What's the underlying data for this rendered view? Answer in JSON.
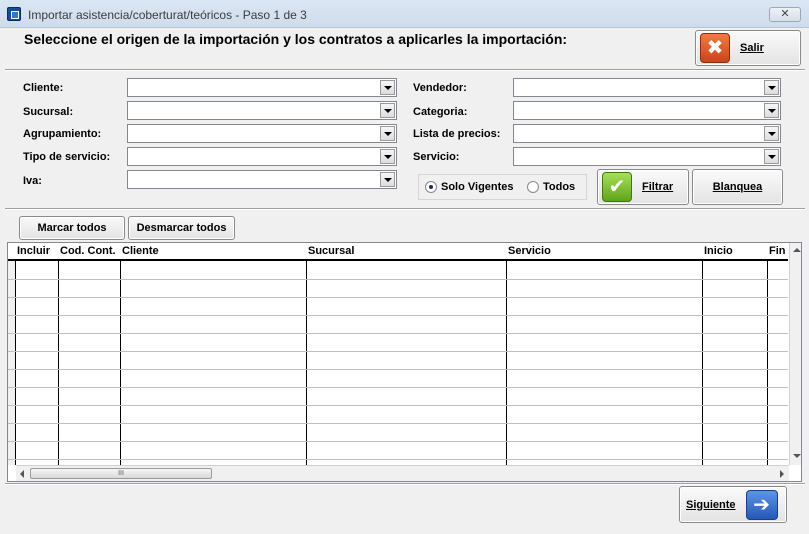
{
  "window": {
    "title": "Importar asistencia/coberturat/teóricos - Paso 1 de 3",
    "close": "✕"
  },
  "headline": "Seleccione el origen de la importación y los contratos a  aplicarles la importación:",
  "buttons": {
    "salir": "Salir",
    "filtrar": "Filtrar",
    "blanquea": "Blanquea",
    "marcar_todos": "Marcar todos",
    "desmarcar_todos": "Desmarcar todos",
    "siguiente": "Siguiente"
  },
  "filters": {
    "left": [
      {
        "label": "Cliente:",
        "value": ""
      },
      {
        "label": "Sucursal:",
        "value": ""
      },
      {
        "label": "Agrupamiento:",
        "value": ""
      },
      {
        "label": "Tipo de servicio:",
        "value": ""
      },
      {
        "label": "Iva:",
        "value": ""
      }
    ],
    "right": [
      {
        "label": "Vendedor:",
        "value": ""
      },
      {
        "label": "Categoria:",
        "value": ""
      },
      {
        "label": "Lista de precios:",
        "value": ""
      },
      {
        "label": "Servicio:",
        "value": ""
      }
    ]
  },
  "radio": {
    "solo_vigentes": "Solo Vigentes",
    "todos": "Todos",
    "selected": "solo_vigentes"
  },
  "grid": {
    "columns": [
      "Incluir",
      "Cod. Cont.",
      "Cliente",
      "Sucursal",
      "Servicio",
      "Inicio",
      "Fin"
    ],
    "rows": [],
    "scroll_thumb": "III"
  },
  "colors": {
    "exit_icon": "#d9531e",
    "filter_icon": "#7cc22a",
    "next_icon": "#2f6fd0"
  }
}
